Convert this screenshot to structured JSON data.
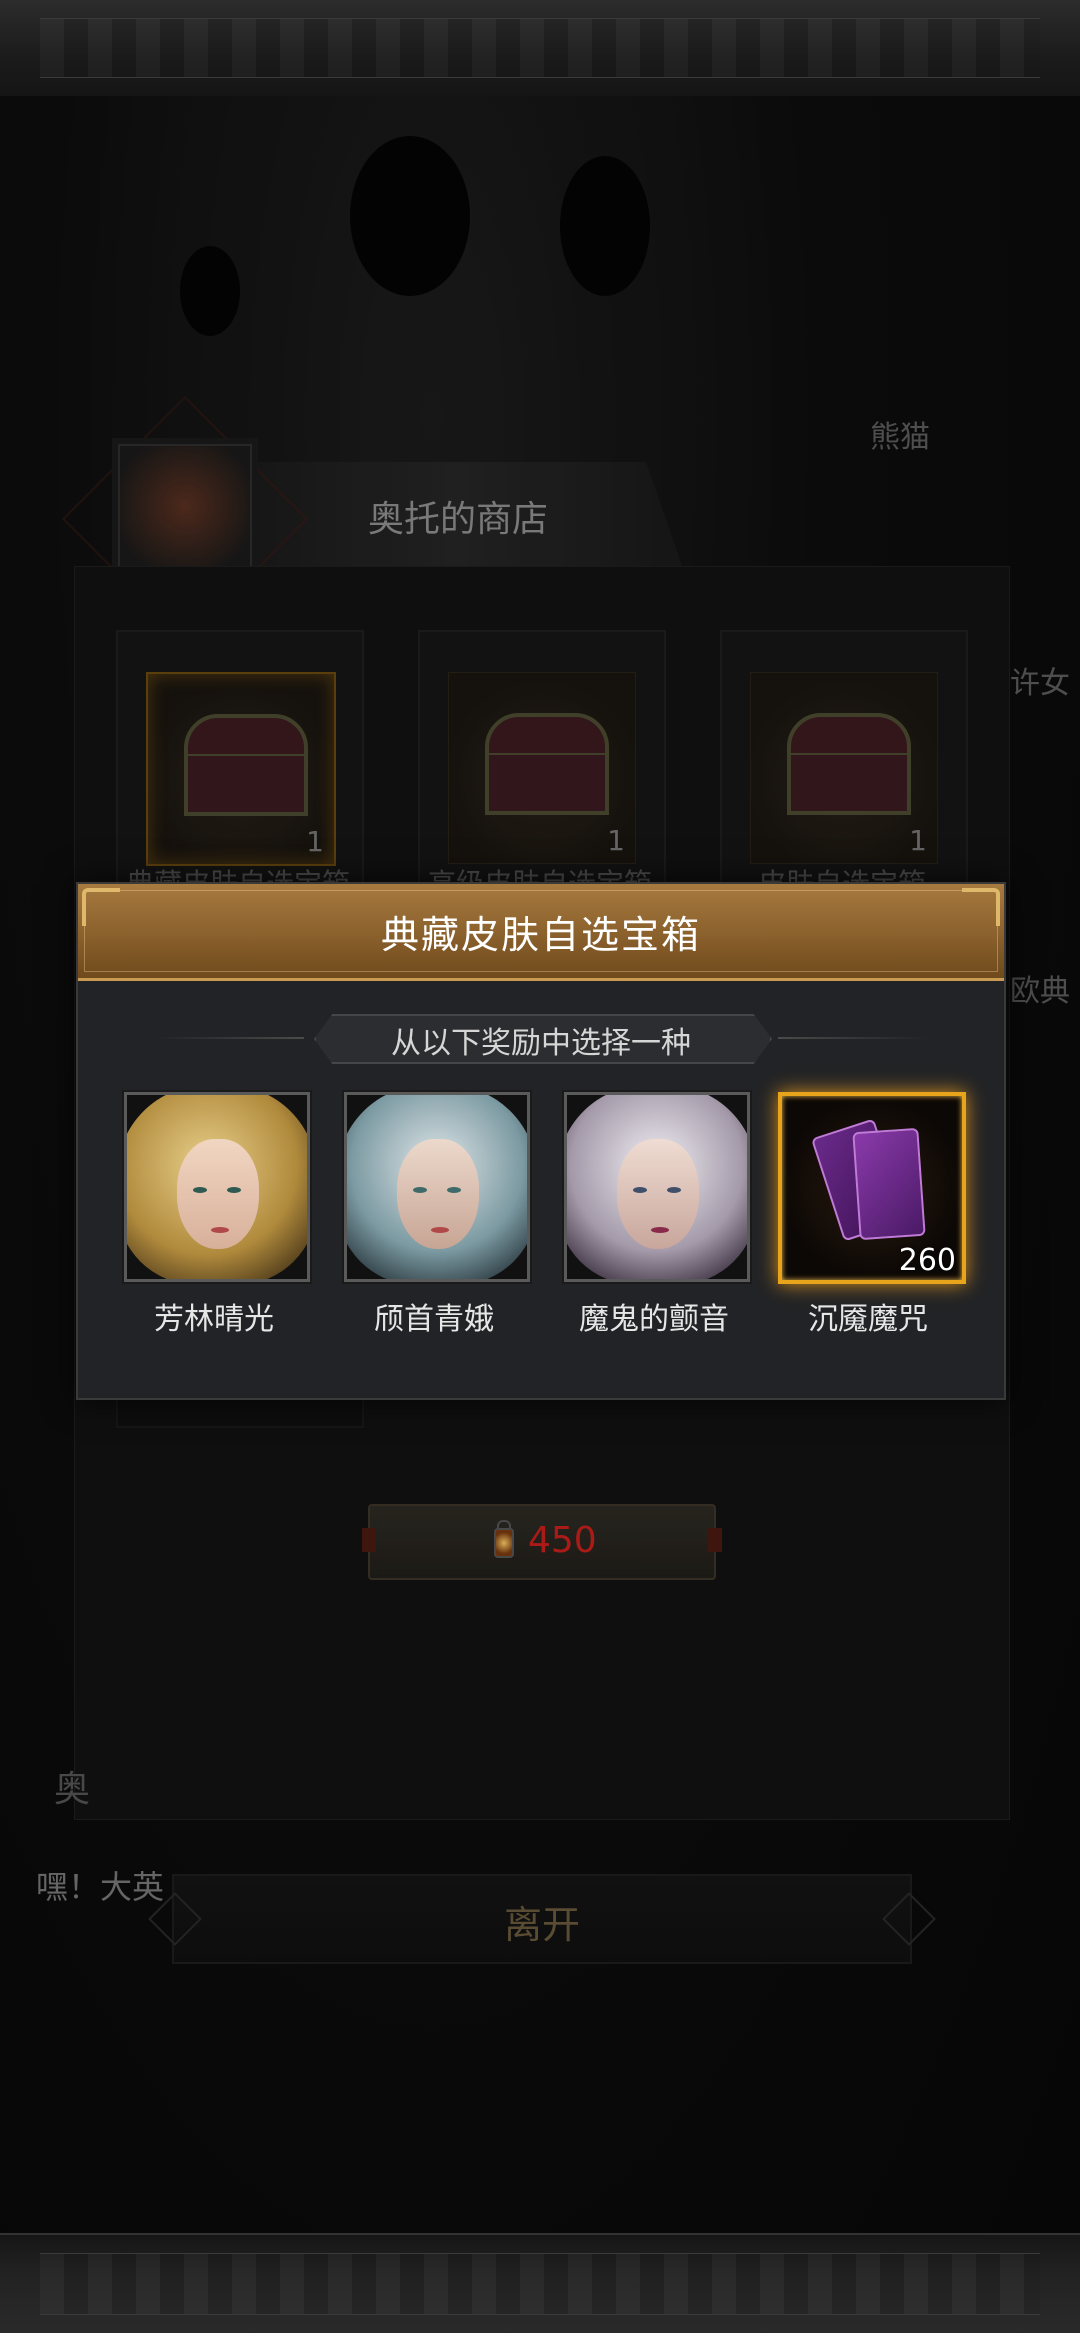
{
  "shop": {
    "title": "奥托的商店",
    "items": [
      {
        "label": "典藏皮肤自选宝箱",
        "count": "1"
      },
      {
        "label": "高级皮肤自选宝箱",
        "count": "1"
      },
      {
        "label": "皮肤自选宝箱",
        "count": "1"
      }
    ],
    "price": "450",
    "leave_label": "离开",
    "speech": "嘿！大英",
    "partial_left": "奥"
  },
  "background": {
    "label_1": "熊猫",
    "label_2": "许女",
    "label_3": "欧典"
  },
  "popup": {
    "title": "典藏皮肤自选宝箱",
    "subtitle": "从以下奖励中选择一种",
    "rewards": [
      {
        "label": "芳林晴光",
        "icon": "portrait-blonde-hero"
      },
      {
        "label": "颀首青娥",
        "icon": "portrait-silver-teal-hero"
      },
      {
        "label": "魔鬼的颤音",
        "icon": "portrait-silver-violet-hero"
      },
      {
        "label": "沉魇魔咒",
        "count": "260",
        "icon": "purple-spell-cards"
      }
    ]
  },
  "colors": {
    "header_gold": "#a77a3f",
    "selected_glow": "#e8a41a",
    "price_red": "#c8201c",
    "panel_bg": "#222326"
  }
}
